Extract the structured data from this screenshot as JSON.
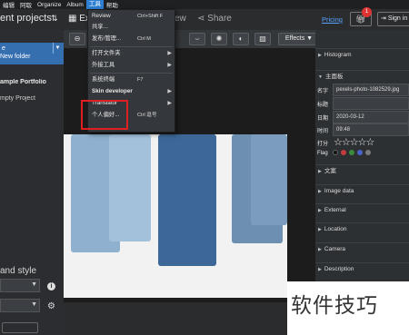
{
  "menubar": {
    "items": [
      "编辑",
      "阿取",
      "Organize",
      "Album",
      "工具",
      "帮助"
    ],
    "active_index": 4
  },
  "header": {
    "projects_title": "ent projects",
    "sort_icon": "sort-icon",
    "tab_label": "Ex",
    "view_label": "ew",
    "share_label": "Share",
    "pricing": "Pricing",
    "badge": "1",
    "signin": "Sign in"
  },
  "left": {
    "selected_top": "e",
    "selected_sub": "New folder",
    "project1": "ample Portfolio",
    "project2": "mpty Project",
    "bottom_title": "and style"
  },
  "toolbar": {
    "effects": "Effects"
  },
  "menu": {
    "items": [
      {
        "label": "Review",
        "shortcut": "Ctrl+Shift F",
        "arrow": ""
      },
      {
        "label": "共享...",
        "shortcut": "",
        "arrow": ""
      },
      {
        "label": "发布/管理...",
        "shortcut": "Ctrl M",
        "arrow": ""
      },
      {
        "label": "打开文件夹",
        "shortcut": "",
        "arrow": "▶"
      },
      {
        "label": "外接工具",
        "shortcut": "",
        "arrow": "▶"
      },
      {
        "label": "系统终端",
        "shortcut": "F7",
        "arrow": ""
      },
      {
        "label": "Skin developer",
        "shortcut": "",
        "arrow": "▶"
      },
      {
        "label": "Translator",
        "shortcut": "",
        "arrow": "▶"
      },
      {
        "label": "个人偏好...",
        "shortcut": "Ctrl 逗号",
        "arrow": ""
      }
    ]
  },
  "right": {
    "histogram": "Histogram",
    "main_panel": "主面板",
    "fields": [
      {
        "key": "名字",
        "value": "pexels-photo-1082529.jpg"
      },
      {
        "key": "标题",
        "value": ""
      },
      {
        "key": "日期",
        "value": "2020-03-12"
      },
      {
        "key": "时间",
        "value": "09:48"
      }
    ],
    "rating_label": "打分",
    "stars": "☆☆☆☆☆",
    "flag_label": "Flag",
    "flag_colors": [
      "#111111",
      "#c33c3c",
      "#3c8a3c",
      "#4a62c4",
      "#7a7a7a"
    ],
    "sections": [
      "文案",
      "Image data",
      "External",
      "Location",
      "Camera",
      "Description"
    ]
  },
  "watermark": "软件技巧"
}
